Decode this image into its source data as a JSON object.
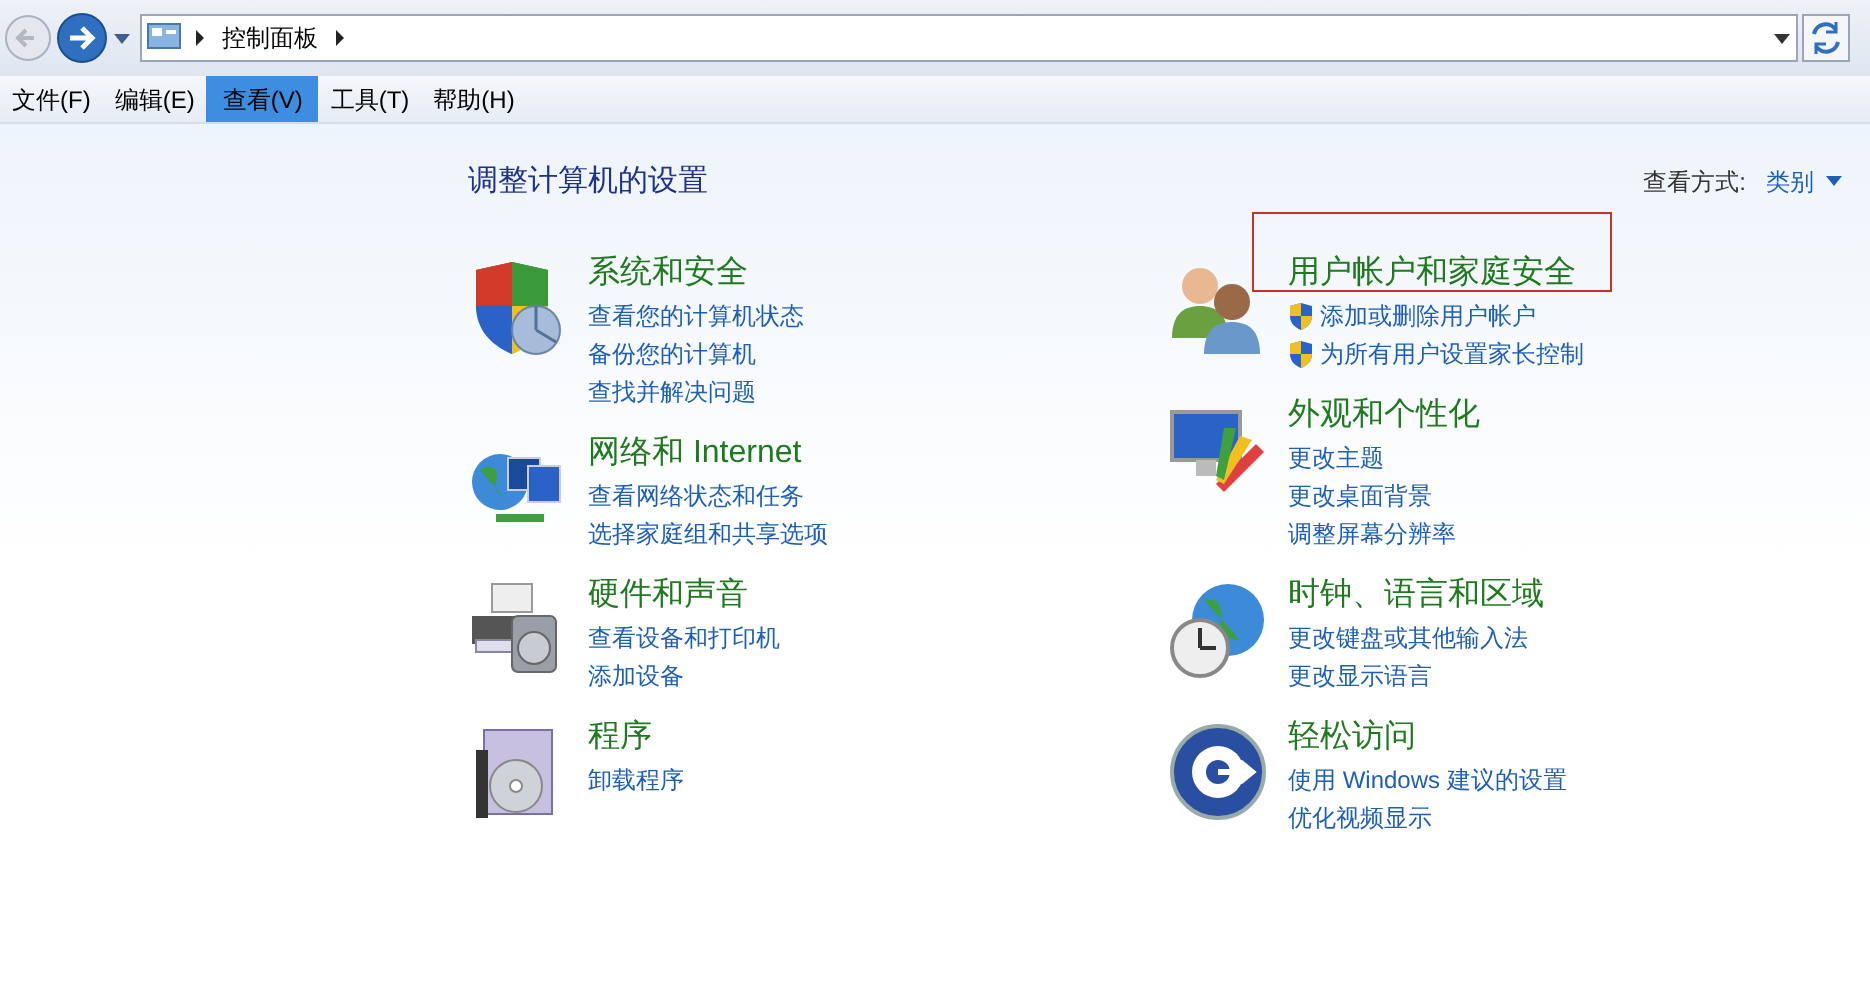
{
  "address_bar": {
    "breadcrumbs": [
      "控制面板"
    ]
  },
  "menu_bar": [
    {
      "label": "文件(F)",
      "selected": false
    },
    {
      "label": "编辑(E)",
      "selected": false
    },
    {
      "label": "查看(V)",
      "selected": true
    },
    {
      "label": "工具(T)",
      "selected": false
    },
    {
      "label": "帮助(H)",
      "selected": false
    }
  ],
  "heading": "调整计算机的设置",
  "view_by": {
    "label": "查看方式:",
    "value": "类别"
  },
  "columns": [
    [
      {
        "kind": "security",
        "title": "系统和安全",
        "highlighted": false,
        "links": [
          {
            "text": "查看您的计算机状态",
            "shield": false
          },
          {
            "text": "备份您的计算机",
            "shield": false
          },
          {
            "text": "查找并解决问题",
            "shield": false
          }
        ]
      },
      {
        "kind": "network",
        "title": "网络和 Internet",
        "highlighted": false,
        "links": [
          {
            "text": "查看网络状态和任务",
            "shield": false
          },
          {
            "text": "选择家庭组和共享选项",
            "shield": false
          }
        ]
      },
      {
        "kind": "hardware",
        "title": "硬件和声音",
        "highlighted": false,
        "links": [
          {
            "text": "查看设备和打印机",
            "shield": false
          },
          {
            "text": "添加设备",
            "shield": false
          }
        ]
      },
      {
        "kind": "programs",
        "title": "程序",
        "highlighted": false,
        "links": [
          {
            "text": "卸载程序",
            "shield": false
          }
        ]
      }
    ],
    [
      {
        "kind": "users",
        "title": "用户帐户和家庭安全",
        "highlighted": true,
        "links": [
          {
            "text": "添加或删除用户帐户",
            "shield": true
          },
          {
            "text": "为所有用户设置家长控制",
            "shield": true
          }
        ]
      },
      {
        "kind": "appearance",
        "title": "外观和个性化",
        "highlighted": false,
        "links": [
          {
            "text": "更改主题",
            "shield": false
          },
          {
            "text": "更改桌面背景",
            "shield": false
          },
          {
            "text": "调整屏幕分辨率",
            "shield": false
          }
        ]
      },
      {
        "kind": "clock",
        "title": "时钟、语言和区域",
        "highlighted": false,
        "links": [
          {
            "text": "更改键盘或其他输入法",
            "shield": false
          },
          {
            "text": "更改显示语言",
            "shield": false
          }
        ]
      },
      {
        "kind": "access",
        "title": "轻松访问",
        "highlighted": false,
        "links": [
          {
            "text": "使用 Windows 建议的设置",
            "shield": false
          },
          {
            "text": "优化视频显示",
            "shield": false
          }
        ]
      }
    ]
  ]
}
